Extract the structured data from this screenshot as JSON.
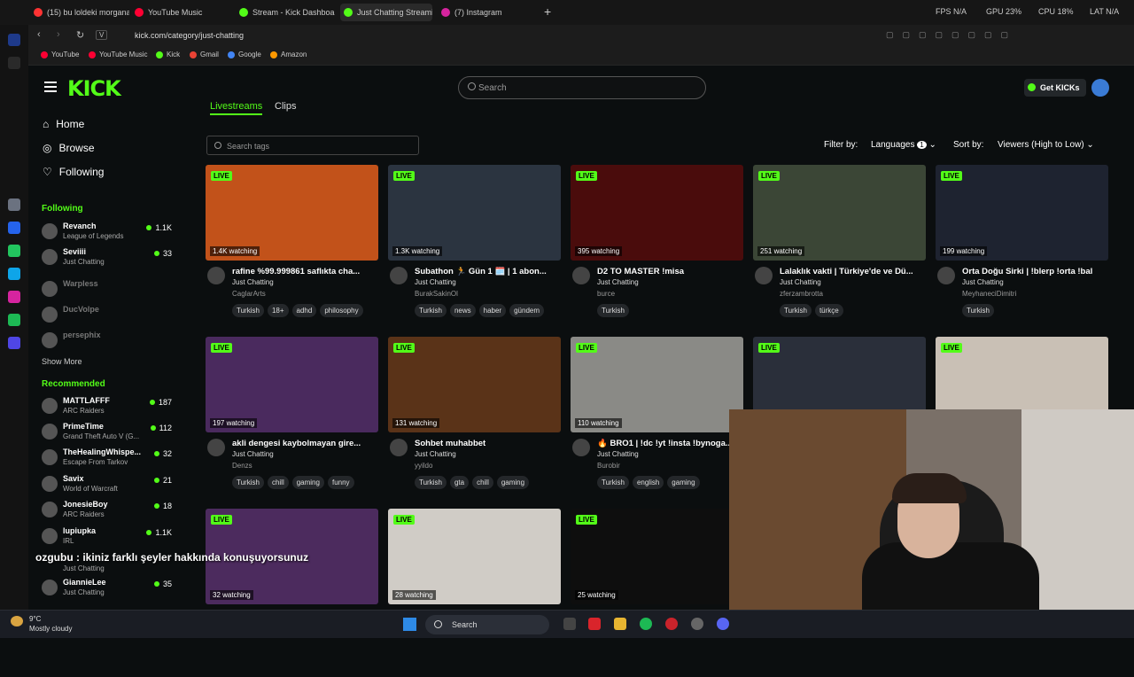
{
  "browser": {
    "tabs": [
      {
        "label": "(15) bu loldeki morganaya",
        "color": "#ff3333"
      },
      {
        "label": "YouTube Music",
        "color": "#ff0033"
      },
      {
        "label": "Stream - Kick Dashboard",
        "color": "#53fc18"
      },
      {
        "label": "Just Chatting Streaming",
        "color": "#53fc18"
      },
      {
        "label": "(7) Instagram",
        "color": "#d6249f"
      }
    ],
    "url": "kick.com/category/just-chatting",
    "url_prefix": "V",
    "bookmarks": [
      "YouTube",
      "YouTube Music",
      "Kick",
      "Gmail",
      "Google",
      "Amazon"
    ],
    "system_stats": {
      "fps": "FPS  N/A",
      "gpu": "GPU  23%",
      "cpu": "CPU  18%",
      "lat": "LAT  N/A"
    }
  },
  "header": {
    "logo": "KICK",
    "search_placeholder": "Search",
    "get_kicks": "Get KICKs"
  },
  "sidebar": {
    "nav": [
      {
        "label": "Home",
        "icon": "home-icon"
      },
      {
        "label": "Browse",
        "icon": "compass-icon"
      },
      {
        "label": "Following",
        "icon": "heart-icon"
      }
    ],
    "following_title": "Following",
    "following": [
      {
        "name": "Revanch",
        "game": "League of Legends",
        "viewers": "1.1K"
      },
      {
        "name": "Seviiii",
        "game": "Just Chatting",
        "viewers": "33"
      },
      {
        "name": "Warpless",
        "game": "",
        "viewers": ""
      },
      {
        "name": "DucVolpe",
        "game": "",
        "viewers": ""
      },
      {
        "name": "persephix",
        "game": "",
        "viewers": ""
      }
    ],
    "show_more": "Show More",
    "recommended_title": "Recommended",
    "recommended": [
      {
        "name": "MATTLAFFF",
        "game": "ARC Raiders",
        "viewers": "187"
      },
      {
        "name": "PrimeTime",
        "game": "Grand Theft Auto V (G...",
        "viewers": "112"
      },
      {
        "name": "TheHealingWhispe...",
        "game": "Escape From Tarkov",
        "viewers": "32"
      },
      {
        "name": "Savix",
        "game": "World of Warcraft",
        "viewers": "21"
      },
      {
        "name": "JonesieBoy",
        "game": "ARC Raiders",
        "viewers": "18"
      },
      {
        "name": "lupiupka",
        "game": "IRL",
        "viewers": "1.1K"
      },
      {
        "name": "ozgubu",
        "game": "Just Chatting",
        "viewers": ""
      },
      {
        "name": "GiannieLee",
        "game": "Just Chatting",
        "viewers": "35"
      }
    ]
  },
  "content": {
    "tabs": [
      "Livestreams",
      "Clips"
    ],
    "tag_search_placeholder": "Search tags",
    "filter_label": "Filter by:",
    "languages_label": "Languages",
    "languages_count": "1",
    "sort_label": "Sort by:",
    "sort_value": "Viewers (High to Low)",
    "live_label": "LIVE",
    "streams": [
      {
        "watching": "1.4K watching",
        "title": "rafine %99.999861 saflıkta cha...",
        "category": "Just Chatting",
        "streamer": "CaglarArts",
        "tags": [
          "Turkish",
          "18+",
          "adhd",
          "philosophy"
        ],
        "thumb": "#c2521a"
      },
      {
        "watching": "1.3K watching",
        "title": "Subathon 🏃 Gün 1 🗓️ | 1 abon...",
        "category": "Just Chatting",
        "streamer": "BurakSakinOl",
        "tags": [
          "Turkish",
          "news",
          "haber",
          "gündem"
        ],
        "thumb": "#2b3440"
      },
      {
        "watching": "395 watching",
        "title": "D2 TO MASTER !misa",
        "category": "Just Chatting",
        "streamer": "burce",
        "tags": [
          "Turkish"
        ],
        "thumb": "#4a0c0c"
      },
      {
        "watching": "251 watching",
        "title": "Lalaklık vakti | Türkiye'de ve Dü...",
        "category": "Just Chatting",
        "streamer": "zferzambrotta",
        "tags": [
          "Turkish",
          "türkçe"
        ],
        "thumb": "#3b4636"
      },
      {
        "watching": "199 watching",
        "title": "Orta Doğu Sirki | !blerp !orta !bal",
        "category": "Just Chatting",
        "streamer": "MeyhaneciDimitri",
        "tags": [
          "Turkish"
        ],
        "thumb": "#1e2330"
      },
      {
        "watching": "197 watching",
        "title": "akli dengesi kaybolmayan gire...",
        "category": "Just Chatting",
        "streamer": "Denzs",
        "tags": [
          "Turkish",
          "chill",
          "gaming",
          "funny"
        ],
        "thumb": "#4a2a5e"
      },
      {
        "watching": "131 watching",
        "title": "Sohbet muhabbet",
        "category": "Just Chatting",
        "streamer": "yyildo",
        "tags": [
          "Turkish",
          "gta",
          "chill",
          "gaming"
        ],
        "thumb": "#5a3318"
      },
      {
        "watching": "110 watching",
        "title": "🔥 BRO1 | !dc !yt !insta !bynoga...",
        "category": "Just Chatting",
        "streamer": "Burobir",
        "tags": [
          "Turkish",
          "english",
          "gaming"
        ],
        "thumb": "#8a8a86"
      },
      {
        "watching": "",
        "title": "",
        "category": "",
        "streamer": "",
        "tags": [],
        "thumb": "#2a2f3a"
      },
      {
        "watching": "",
        "title": "",
        "category": "",
        "streamer": "",
        "tags": [],
        "thumb": "#c9c0b5"
      },
      {
        "watching": "32 watching",
        "title": "",
        "category": "",
        "streamer": "",
        "tags": [],
        "thumb": "#4c2b5e"
      },
      {
        "watching": "28 watching",
        "title": "",
        "category": "",
        "streamer": "",
        "tags": [],
        "thumb": "#d0ccc6"
      },
      {
        "watching": "25 watching",
        "title": "",
        "category": "",
        "streamer": "",
        "tags": [],
        "thumb": "#0e0e0e"
      }
    ]
  },
  "overlay": {
    "subtitle": "ozgubu : ikiniz farklı şeyler hakkında konuşuyorsunuz"
  },
  "taskbar": {
    "weather_temp": "9°C",
    "weather_desc": "Mostly cloudy",
    "search": "Search"
  },
  "colors": {
    "accent": "#53fc18",
    "background": "#0b0e0f"
  }
}
